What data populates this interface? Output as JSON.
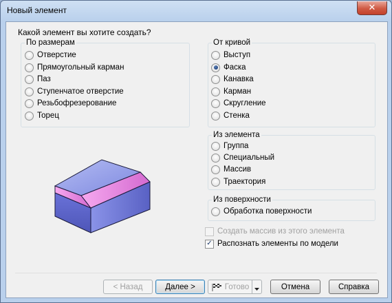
{
  "window": {
    "title": "Новый элемент",
    "close_glyph": "✕"
  },
  "prompt": "Какой элемент вы хотите создать?",
  "groups": {
    "by_size": {
      "legend": "По размерам",
      "options": [
        "Отверстие",
        "Прямоугольный карман",
        "Паз",
        "Ступенчатое отверстие",
        "Резьбофрезерование",
        "Торец"
      ]
    },
    "from_curve": {
      "legend": "От кривой",
      "options": [
        "Выступ",
        "Фаска",
        "Канавка",
        "Карман",
        "Скругление",
        "Стенка"
      ],
      "selected": "Фаска"
    },
    "from_feature": {
      "legend": "Из элемента",
      "options": [
        "Группа",
        "Специальный",
        "Массив",
        "Траектория"
      ]
    },
    "from_surface": {
      "legend": "Из поверхности",
      "options": [
        "Обработка поверхности"
      ]
    }
  },
  "checkboxes": {
    "create_array": {
      "label": "Создать массив из этого элемента",
      "checked": false,
      "enabled": false
    },
    "recognize": {
      "label": "Распознать элементы по модели",
      "checked": true,
      "enabled": true,
      "mark": "✓"
    }
  },
  "buttons": {
    "back": "< Назад",
    "next": "Далее >",
    "finish": "Готово",
    "cancel": "Отмена",
    "help": "Справка"
  },
  "icons": [
    "close-icon",
    "checkered-flag-icon",
    "dropdown-arrow-icon",
    "chamfer-preview-image"
  ],
  "colors": {
    "preview_face_top": "#8c98e6",
    "preview_chamfer": "#ec86e2",
    "preview_side": "#6a72d8"
  }
}
